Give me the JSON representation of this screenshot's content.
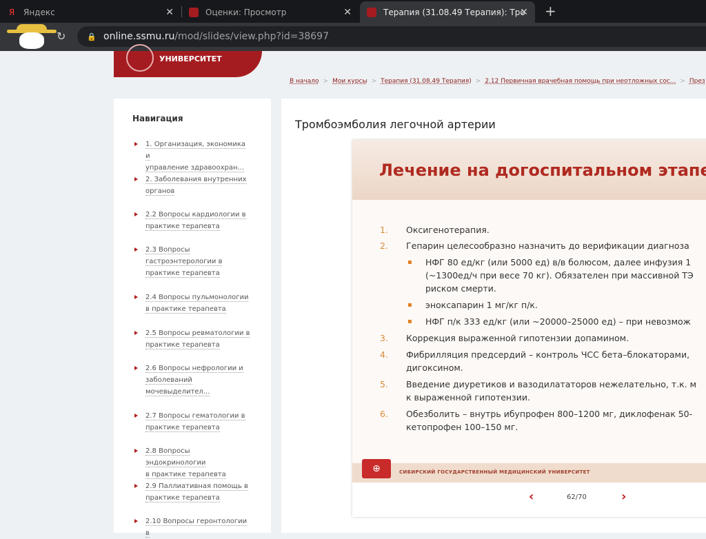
{
  "browser": {
    "tabs": [
      {
        "label": "Яндекс",
        "icon": "Я"
      },
      {
        "label": "Оценки: Просмотр"
      },
      {
        "label": "Терапия (31.08.49 Терапия): Тро"
      }
    ],
    "url_host": "online.ssmu.ru",
    "url_path": "/mod/slides/view.php?id=38697"
  },
  "header": {
    "logo_text": "УНИВЕРСИТЕТ"
  },
  "breadcrumb": [
    "В начало",
    "Мои курсы",
    "Терапия (31.08.49 Терапия)",
    "2.12 Первичная врачебная помощь при неотложных сос...",
    "През"
  ],
  "nav": {
    "title": "Навигация",
    "items": [
      [
        "1. Организация, экономика и",
        "управление здравоохран..."
      ],
      [
        "2. Заболевания внутренних",
        "органов"
      ],
      [
        "2.2 Вопросы кардиологии в",
        "практике терапевта"
      ],
      [
        "2.3 Вопросы",
        "гастроэнтерологии в",
        "практике терапевта"
      ],
      [
        "2.4 Вопросы пульмонологии",
        "в практике терапевта"
      ],
      [
        "2.5 Вопросы ревматологии в",
        "практике терапевта"
      ],
      [
        "2.6 Вопросы нефрологии и",
        "заболеваний",
        "мочевыделител..."
      ],
      [
        "2.7 Вопросы гематологии в",
        "практике терапевта"
      ],
      [
        "2.8 Вопросы эндокринологии",
        "в практике терапевта"
      ],
      [
        "2.9 Паллиативная помощь в",
        "практике терапевта"
      ],
      [
        "2.10 Вопросы геронтологии в"
      ]
    ]
  },
  "main": {
    "title": "Тромбоэмболия легочной артерии"
  },
  "slide": {
    "heading": "Лечение на догоспитальном этапе",
    "lines": [
      {
        "n": "1.",
        "t": "Оксигенотерапия."
      },
      {
        "n": "2.",
        "t": "Гепарин целесообразно назначить до верификации диагноза"
      },
      {
        "n": "▪",
        "t": "НФГ 80 ед/кг (или 5000 ед) в/в болюсом, далее инфузия 1",
        "sub": true
      },
      {
        "n": "",
        "t": "(~1300ед/ч при весе 70 кг). Обязателен при массивной ТЭ",
        "sub": true
      },
      {
        "n": "",
        "t": "риском смерти.",
        "sub": true
      },
      {
        "n": "▪",
        "t": "эноксапарин 1 мг/кг п/к.",
        "sub": true
      },
      {
        "n": "▪",
        "t": "НФГ п/к 333 ед/кг (или ~20000–25000 ед) – при невозмож",
        "sub": true
      },
      {
        "n": "3.",
        "t": "Коррекция выраженной гипотензии допамином."
      },
      {
        "n": "4.",
        "t": "Фибрилляция предсердий – контроль ЧСС бета–блокаторами,"
      },
      {
        "n": "",
        "t": "дигоксином."
      },
      {
        "n": "5.",
        "t": "Введение диуретиков и вазодилататоров нежелательно, т.к. м"
      },
      {
        "n": "",
        "t": "к выраженной гипотензии."
      },
      {
        "n": "6.",
        "t": "Обезболить – внутрь ибупрофен 800–1200 мг, диклофенак 50-"
      },
      {
        "n": "",
        "t": "кетопрофен 100–150 мг."
      }
    ],
    "footer": "СИБИРСКИЙ ГОСУДАРСТВЕННЫЙ МЕДИЦИНСКИЙ УНИВЕРСИТЕТ",
    "page": "62/70"
  }
}
